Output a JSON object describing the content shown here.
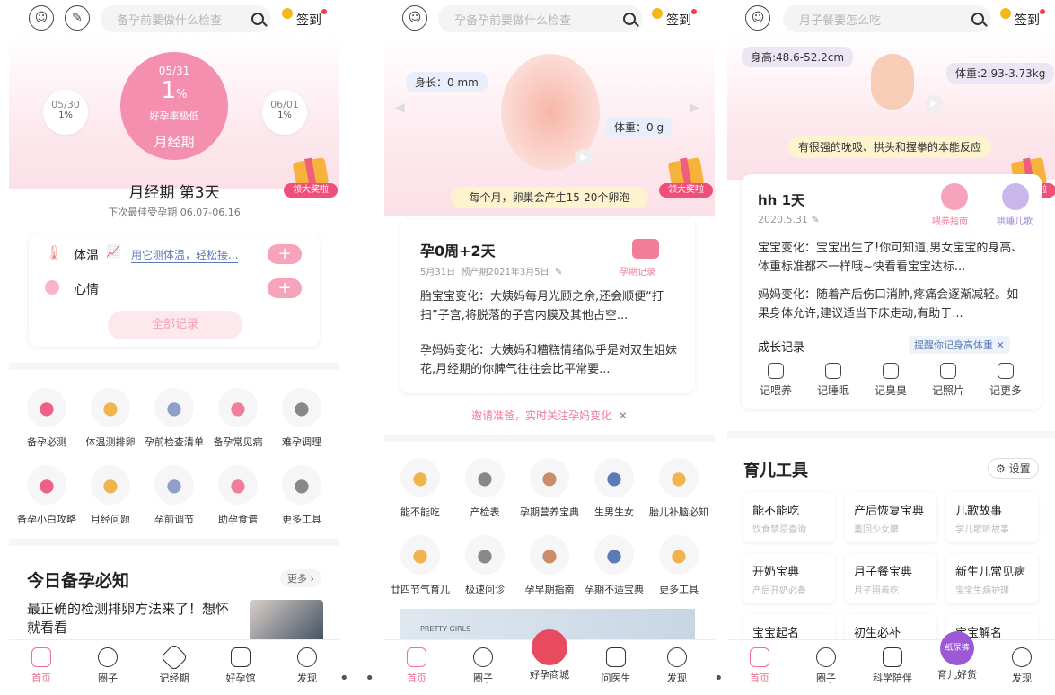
{
  "s1": {
    "search_placeholder": "备孕前要做什么检查",
    "signin": "签到",
    "prev": {
      "date": "05/30",
      "pct": "1%"
    },
    "cur": {
      "date": "05/31",
      "pct": "1",
      "pct_unit": "%",
      "status": "好孕率极低",
      "phase": "月经期"
    },
    "next": {
      "date": "06/01",
      "pct": "1%"
    },
    "gift": "领大奖啦",
    "title": "月经期 第3天",
    "subtitle": "下次最佳受孕期 06.07-06.16",
    "temp_label": "体温",
    "temp_hint": "用它测体温，轻松接...",
    "mood_label": "心情",
    "all_records": "全部记录",
    "grid": [
      "备孕必测",
      "体温测排卵",
      "孕前检查清单",
      "备孕常见病",
      "难孕调理",
      "备孕小白攻略",
      "月经问题",
      "孕前调节",
      "助孕食谱",
      "更多工具"
    ],
    "section_title": "今日备孕必知",
    "more": "更多",
    "article": "最正确的检测排卵方法来了！想怀就看看",
    "tabs": [
      "首页",
      "圈子",
      "记经期",
      "好孕馆",
      "发现"
    ]
  },
  "s2": {
    "search_placeholder": "孕备孕前要做什么检查",
    "signin": "签到",
    "height": "身长：0 mm",
    "weight": "体重：0 g",
    "gift": "领大奖啦",
    "banner": "每个月，卵巢会产生15-20个卵泡",
    "title": "孕0周+2天",
    "date": "5月31日",
    "due": "预产期2021年3月5日",
    "record": "孕期记录",
    "baby_change": "胎宝宝变化：大姨妈每月光顾之余,还会顺便“打扫”子宫,将脱落的子宫内膜及其他占空...",
    "mom_change": "孕妈妈变化：大姨妈和糟糕情绪似乎是对双生姐妹花,月经期的你脾气往往会比平常要...",
    "invite": "邀请准爸，实时关注孕妈变化",
    "grid": [
      "能不能吃",
      "产检表",
      "孕期营养宝典",
      "生男生女",
      "胎儿补脑必知",
      "廿四节气育儿",
      "极速问诊",
      "孕早期指南",
      "孕期不适宝典",
      "更多工具"
    ],
    "ad": "PRETTY GIRLS",
    "tabs": [
      "首页",
      "圈子",
      "好孕商城",
      "问医生",
      "发现"
    ]
  },
  "s3": {
    "search_placeholder": "月子餐要怎么吃",
    "signin": "签到",
    "height": "身高:48.6-52.2cm",
    "weight": "体重:2.93-3.73kg",
    "banner": "有很强的吮吸、拱头和握拳的本能反应",
    "gift": "领大奖啦",
    "title": "hh 1天",
    "date": "2020.5.31",
    "feed": "喂养指南",
    "lullaby": "哄睡儿歌",
    "baby_change": "宝宝变化：宝宝出生了!你可知道,男女宝宝的身高、体重标准都不一样哦~快看看宝宝达标...",
    "mom_change": "妈妈变化：随着产后伤口消肿,疼痛会逐渐减轻。如果身体允许,建议适当下床走动,有助于...",
    "growth": "成长记录",
    "remind": "提醒你记身高体重",
    "records": [
      "记喂养",
      "记睡眠",
      "记臭臭",
      "记照片",
      "记更多"
    ],
    "tools_title": "育儿工具",
    "settings": "设置",
    "tools": [
      {
        "t": "能不能吃",
        "s": "饮食禁忌查询"
      },
      {
        "t": "产后恢复宝典",
        "s": "重回少女腰"
      },
      {
        "t": "儿歌故事",
        "s": "学儿歌听故事"
      },
      {
        "t": "开奶宝典",
        "s": "产后开奶必备"
      },
      {
        "t": "月子餐宝典",
        "s": "月子照着吃"
      },
      {
        "t": "新生儿常见病",
        "s": "宝宝生病护理"
      },
      {
        "t": "宝宝起名",
        "s": ""
      },
      {
        "t": "初生必补",
        "s": ""
      },
      {
        "t": "宝宝解名",
        "s": ""
      }
    ],
    "diaper": "纸尿裤",
    "tabs": [
      "首页",
      "圈子",
      "科学陪伴",
      "育儿好货",
      "发现"
    ]
  }
}
